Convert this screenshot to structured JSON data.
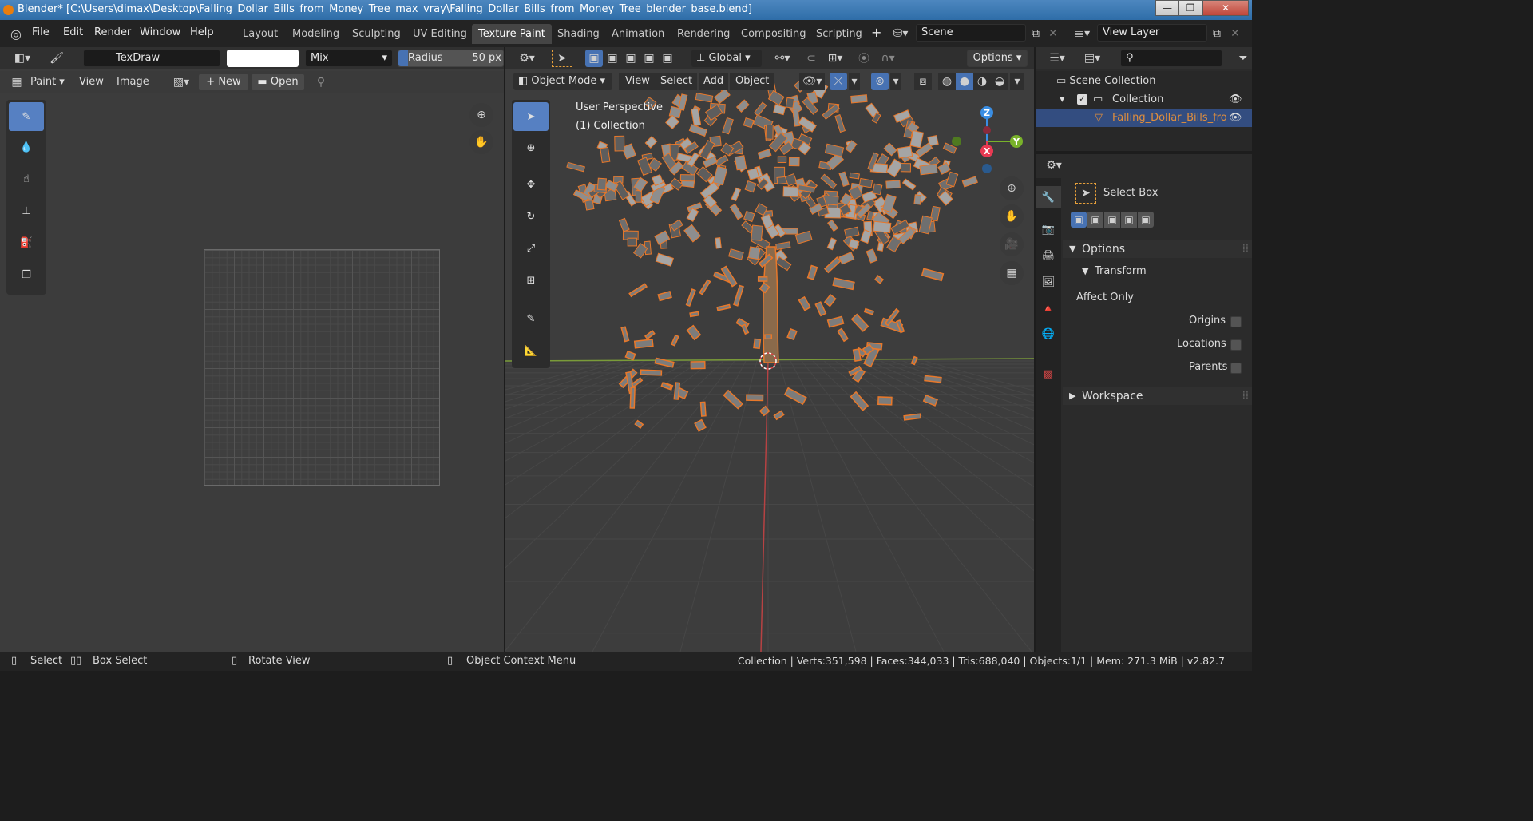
{
  "window": {
    "title": "Blender* [C:\\Users\\dimax\\Desktop\\Falling_Dollar_Bills_from_Money_Tree_max_vray\\Falling_Dollar_Bills_from_Money_Tree_blender_base.blend]",
    "minimize": "—",
    "maximize": "❐",
    "close": "✕"
  },
  "menu": {
    "file": "File",
    "edit": "Edit",
    "render": "Render",
    "window": "Window",
    "help": "Help"
  },
  "workspaces": [
    "Layout",
    "Modeling",
    "Sculpting",
    "UV Editing",
    "Texture Paint",
    "Shading",
    "Animation",
    "Rendering",
    "Compositing",
    "Scripting"
  ],
  "active_workspace": "Texture Paint",
  "add_workspace": "+",
  "scene": {
    "name": "Scene",
    "view_layer": "View Layer"
  },
  "image_editor": {
    "brush_name": "TexDraw",
    "brush_color": "#ffffff",
    "blend_mode": "Mix",
    "radius_label": "Radius",
    "radius_value": "50 px",
    "mode": "Paint",
    "view": "View",
    "image": "Image",
    "new": "New",
    "open": "Open"
  },
  "viewport": {
    "orientation": "Global",
    "options": "Options",
    "mode": "Object Mode",
    "menu_view": "View",
    "menu_select": "Select",
    "menu_add": "Add",
    "menu_object": "Object",
    "overlay_line1": "User Perspective",
    "overlay_line2": "(1) Collection",
    "gizmo": {
      "x": "X",
      "y": "Y",
      "z": "Z",
      "x_color": "#e83a52",
      "y_color": "#79b22a",
      "z_color": "#3a8ee3"
    },
    "selection_color": "#e8782a"
  },
  "outliner": {
    "scene_collection": "Scene Collection",
    "collection": "Collection",
    "object": "Falling_Dollar_Bills_from",
    "object_color": "#e08e3c"
  },
  "properties": {
    "tool": "Select Box",
    "options": "Options",
    "transform": "Transform",
    "affect_only": "Affect Only",
    "origins": "Origins",
    "locations": "Locations",
    "parents": "Parents",
    "workspace": "Workspace"
  },
  "status": {
    "select": "Select",
    "box_select": "Box Select",
    "rotate_view": "Rotate View",
    "context_menu": "Object Context Menu",
    "stats": "Collection | Verts:351,598 | Faces:344,033 | Tris:688,040 | Objects:1/1 | Mem: 271.3 MiB | v2.82.7"
  }
}
